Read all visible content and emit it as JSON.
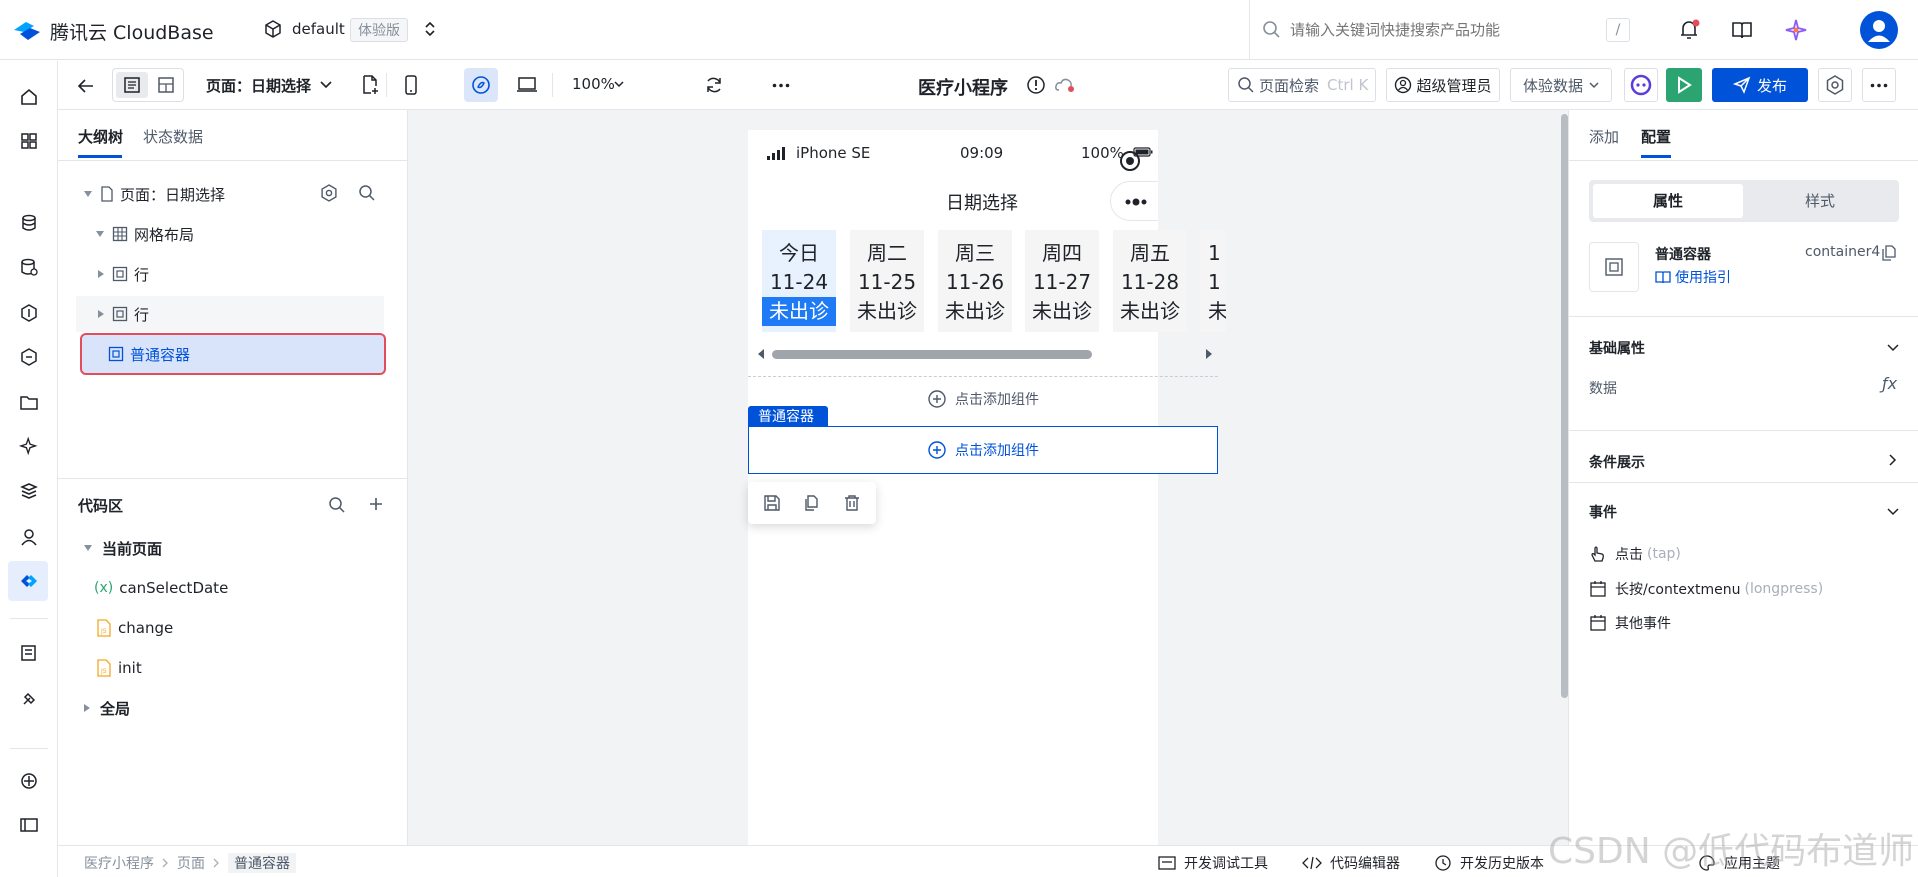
{
  "topbar": {
    "brand": "腾讯云 CloudBase",
    "env": "default",
    "env_badge": "体验版",
    "search_placeholder": "请输入关键词快捷搜索产品功能",
    "search_shortcut": "/"
  },
  "toolbar": {
    "page_label": "页面：日期选择",
    "zoom": "100%",
    "app_title": "医疗小程序",
    "page_search": "页面检索",
    "page_search_shortcut": "Ctrl K",
    "admin": "超级管理员",
    "data_mode": "体验数据",
    "publish": "发布"
  },
  "left": {
    "tabs": [
      "大纲树",
      "状态数据"
    ],
    "tree": {
      "page": "页面：日期选择",
      "grid": "网格布局",
      "row1": "行",
      "row2": "行",
      "container": "普通容器"
    },
    "code": {
      "title": "代码区",
      "current": "当前页面",
      "items": [
        "canSelectDate",
        "change",
        "init"
      ],
      "var_prefix": "(x)",
      "global": "全局"
    }
  },
  "phone": {
    "carrier": "iPhone SE",
    "time": "09:09",
    "battery": "100%",
    "title": "日期选择",
    "days": [
      {
        "name": "今日",
        "date": "11-24",
        "status": "未出诊"
      },
      {
        "name": "周二",
        "date": "11-25",
        "status": "未出诊"
      },
      {
        "name": "周三",
        "date": "11-26",
        "status": "未出诊"
      },
      {
        "name": "周四",
        "date": "11-27",
        "status": "未出诊"
      },
      {
        "name": "周五",
        "date": "11-28",
        "status": "未出诊"
      },
      {
        "name": "1",
        "date": "1",
        "status": "未"
      }
    ],
    "add1": "点击添加组件",
    "container_tag": "普通容器",
    "add2": "点击添加组件"
  },
  "right": {
    "tabs": [
      "添加",
      "配置"
    ],
    "subtabs": [
      "属性",
      "样式"
    ],
    "comp_name": "普通容器",
    "comp_id": "container4",
    "guide": "使用指引",
    "basic": "基础属性",
    "data_label": "数据",
    "fx": "ƒx",
    "cond": "条件展示",
    "events": "事件",
    "event1": "点击",
    "event1_sub": "(tap)",
    "event2": "长按/contextmenu",
    "event2_sub": "(longpress)",
    "event3": "其他事件"
  },
  "status": {
    "breadcrumb": [
      "医疗小程序",
      "页面",
      "普通容器"
    ],
    "debug": "开发调试工具",
    "editor": "代码编辑器",
    "history": "开发历史版本",
    "theme": "应用主题"
  },
  "watermark": "CSDN @低代码布道师",
  "colors": {
    "accent": "#0052d9",
    "selected_bg": "#d9e4fb",
    "highlight_red": "#e34d59",
    "run_green": "#2ba471"
  }
}
